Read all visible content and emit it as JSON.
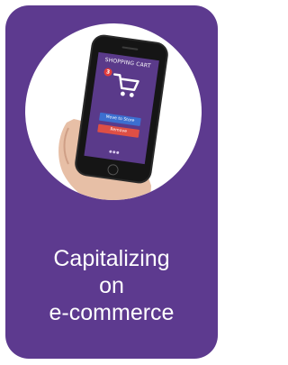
{
  "card": {
    "caption_lines": [
      "Capitalizing",
      "on",
      "e-commerce"
    ]
  },
  "phone": {
    "app_title": "SHOPPING CART",
    "cart_count": "3",
    "primary_button": "Move to Store",
    "secondary_button": "Remove"
  },
  "colors": {
    "card_bg": "#5d3a8f",
    "screen_bg": "#5a3a8a",
    "button_blue": "#3c6fd0",
    "button_red": "#de4f45"
  },
  "icons": {
    "cart": "shopping-cart-icon"
  }
}
